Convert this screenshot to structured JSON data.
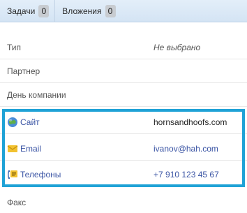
{
  "tabs": [
    {
      "label": "Задачи",
      "count": "0"
    },
    {
      "label": "Вложения",
      "count": "0"
    }
  ],
  "fields": {
    "type": {
      "label": "Тип",
      "value": "Не выбрано"
    },
    "partner": {
      "label": "Партнер",
      "value": ""
    },
    "company_day": {
      "label": "День компании",
      "value": ""
    },
    "fax": {
      "label": "Факс",
      "value": ""
    }
  },
  "contacts": {
    "site": {
      "label": "Сайт",
      "value": "hornsandhoofs.com",
      "icon": "globe-icon"
    },
    "email": {
      "label": "Email",
      "value": "ivanov@hah.com",
      "icon": "envelope-icon"
    },
    "phones": {
      "label": "Телефоны",
      "value": "+7 910 123 45 67",
      "icon": "phone-icon"
    }
  },
  "colors": {
    "highlight": "#1fa2d6",
    "link": "#3a54a4",
    "tabbar": "#dbe8f6"
  }
}
